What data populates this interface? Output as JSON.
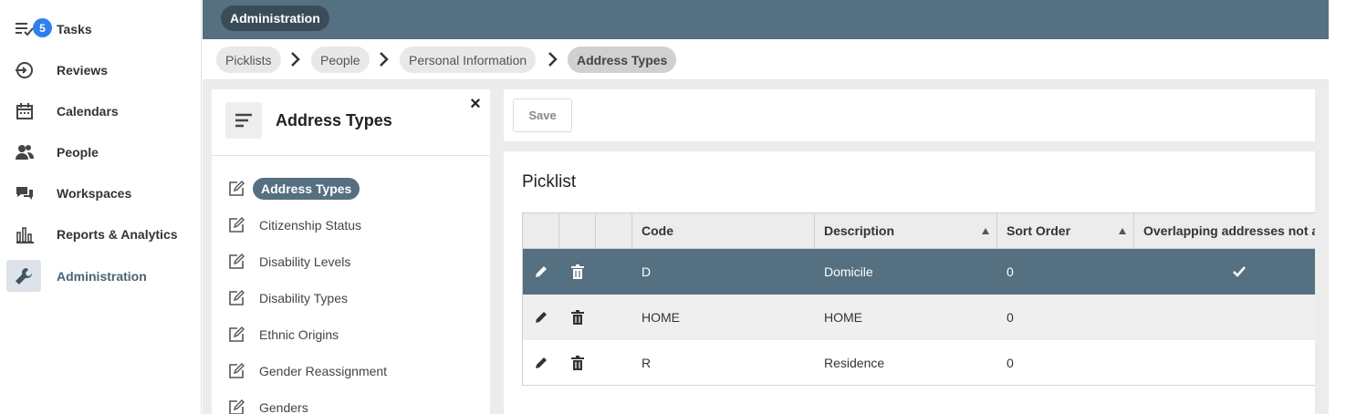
{
  "nav": {
    "items": [
      {
        "label": "Tasks",
        "icon": "tasks-icon",
        "badge": "5"
      },
      {
        "label": "Reviews",
        "icon": "reviews-icon"
      },
      {
        "label": "Calendars",
        "icon": "calendar-icon"
      },
      {
        "label": "People",
        "icon": "people-icon"
      },
      {
        "label": "Workspaces",
        "icon": "chat-icon"
      },
      {
        "label": "Reports & Analytics",
        "icon": "bar-chart-icon"
      },
      {
        "label": "Administration",
        "icon": "wrench-icon",
        "active": true
      }
    ]
  },
  "header": {
    "section": "Administration"
  },
  "breadcrumb": [
    "Picklists",
    "People",
    "Personal Information",
    "Address Types"
  ],
  "left_panel": {
    "title": "Address Types",
    "items": [
      {
        "label": "Address Types",
        "active": true
      },
      {
        "label": "Citizenship Status"
      },
      {
        "label": "Disability Levels"
      },
      {
        "label": "Disability Types"
      },
      {
        "label": "Ethnic Origins"
      },
      {
        "label": "Gender Reassignment"
      },
      {
        "label": "Genders"
      }
    ]
  },
  "toolbar": {
    "save_label": "Save"
  },
  "picklist": {
    "title": "Picklist",
    "columns": [
      "Code",
      "Description",
      "Sort Order",
      "Overlapping addresses not allowed"
    ],
    "rows": [
      {
        "code": "D",
        "description": "Domicile",
        "sort_order": "0",
        "overlap": true,
        "selected": true
      },
      {
        "code": "HOME",
        "description": "HOME",
        "sort_order": "0",
        "overlap": false
      },
      {
        "code": "R",
        "description": "Residence",
        "sort_order": "0",
        "overlap": false
      }
    ]
  },
  "colors": {
    "accent": "#557080",
    "header_dark": "#3a4c57",
    "badge": "#2f80ed"
  }
}
